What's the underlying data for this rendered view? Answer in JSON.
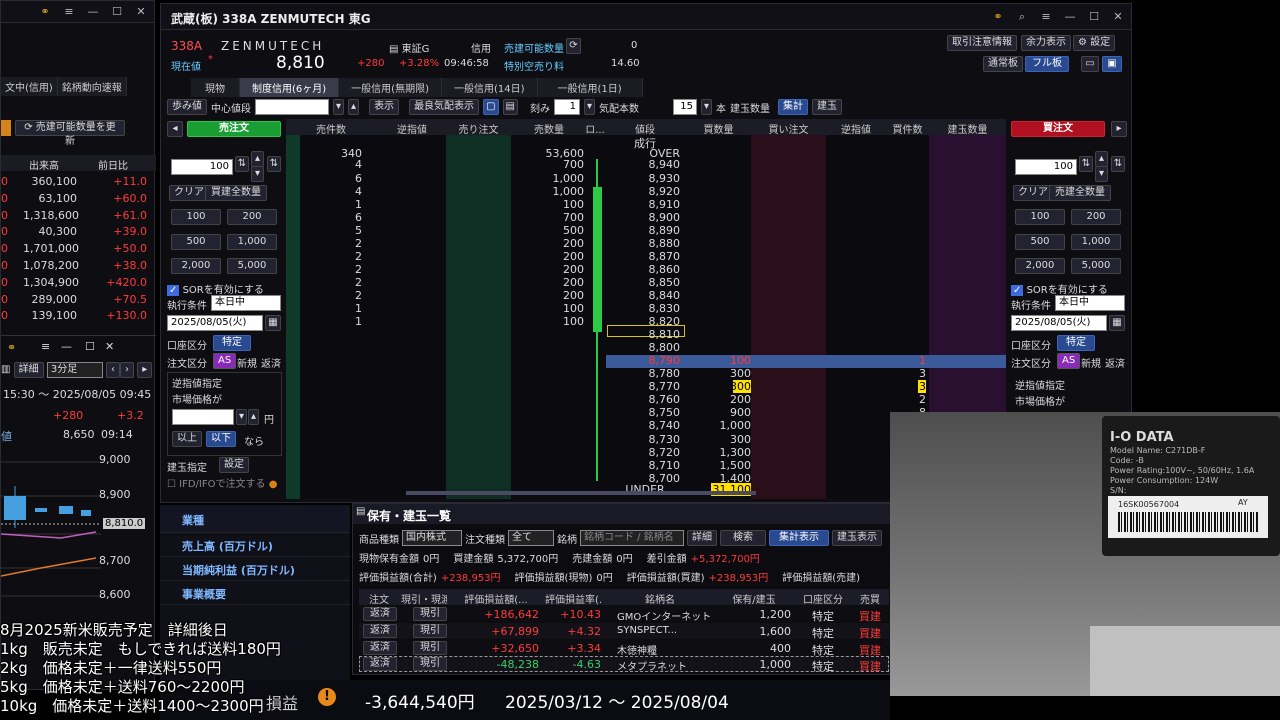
{
  "left_window": {
    "tabs": [
      "文中(信用)",
      "銘柄動向速報"
    ],
    "refresh_button": "売建可能数量を更新",
    "col_headers": [
      "出来高",
      "前日比"
    ],
    "rows": [
      {
        "vol": "360,100",
        "chg": "+11.0"
      },
      {
        "vol": "63,100",
        "chg": "+60.0"
      },
      {
        "vol": "1,318,600",
        "chg": "+61.0"
      },
      {
        "vol": "40,300",
        "chg": "+39.0"
      },
      {
        "vol": "1,701,000",
        "chg": "+50.0"
      },
      {
        "vol": "1,078,200",
        "chg": "+38.0"
      },
      {
        "vol": "1,304,900",
        "chg": "+420.0"
      },
      {
        "vol": "289,000",
        "chg": "+70.5"
      },
      {
        "vol": "139,100",
        "chg": "+130.0"
      }
    ],
    "chart": {
      "detail": "詳細",
      "interval": "3分足",
      "range": "15:30 ～ 2025/08/05 09:45",
      "chg1": "+280",
      "chg2": "+3.2",
      "label": "値",
      "price": "8,650",
      "time": "09:14",
      "yticks": [
        "9,000",
        "8,900",
        "8,810.0",
        "8,700",
        "8,600"
      ]
    }
  },
  "main": {
    "title": "武蔵(板) 338A ZENMUTECH 東G",
    "code": "338A",
    "name": "ZENMUTECH",
    "market": "東証G",
    "credit": "信用",
    "sellable_label": "売建可能数量",
    "sellable_val": "0",
    "special_label": "特別空売り料",
    "special_val": "14.60",
    "cur_label": "現在値",
    "price": "8,810",
    "chg": "+280",
    "pct": "+3.28%",
    "time": "09:46:58",
    "btn_notice": "取引注意情報",
    "btn_margin": "余力表示",
    "btn_settings": "設定",
    "mode_normal": "通常板",
    "mode_full": "フル板",
    "tabs": [
      "現物",
      "制度信用(6ヶ月)",
      "一般信用(無期限)",
      "一般信用(14日)",
      "一般信用(1日)"
    ],
    "toolbar": {
      "ayumi": "歩み値",
      "center": "中心値段",
      "display": "表示",
      "best": "最良気配表示",
      "tick_label": "刻み",
      "tick_val": "1",
      "depth_label": "気配本数",
      "depth_val": "15",
      "unit": "本",
      "position": "建玉数量",
      "summary": "集計",
      "build": "建玉"
    },
    "book_headers": [
      "売件数",
      "逆指値",
      "売り注文",
      "売数量",
      "ロ...",
      "値段",
      "買数量",
      "買い注文",
      "逆指値",
      "買件数",
      "建玉数量"
    ],
    "market_order": "成行",
    "over": {
      "label": "OVER",
      "qty": "53,600",
      "count": "340"
    },
    "asks": [
      {
        "count": "4",
        "qty": "700",
        "price": "8,940"
      },
      {
        "count": "6",
        "qty": "1,000",
        "price": "8,930"
      },
      {
        "count": "4",
        "qty": "1,000",
        "price": "8,920"
      },
      {
        "count": "1",
        "qty": "100",
        "price": "8,910"
      },
      {
        "count": "6",
        "qty": "700",
        "price": "8,900"
      },
      {
        "count": "5",
        "qty": "500",
        "price": "8,890"
      },
      {
        "count": "2",
        "qty": "200",
        "price": "8,880"
      },
      {
        "count": "2",
        "qty": "200",
        "price": "8,870"
      },
      {
        "count": "2",
        "qty": "200",
        "price": "8,860"
      },
      {
        "count": "2",
        "qty": "200",
        "price": "8,850"
      },
      {
        "count": "2",
        "qty": "200",
        "price": "8,840"
      },
      {
        "count": "1",
        "qty": "100",
        "price": "8,830"
      },
      {
        "count": "1",
        "qty": "100",
        "price": "8,820"
      }
    ],
    "current": "8,810",
    "mid": "8,800",
    "bids": [
      {
        "price": "8,790",
        "qty": "100",
        "count": "1"
      },
      {
        "price": "8,780",
        "qty": "300",
        "count": "3"
      },
      {
        "price": "8,770",
        "qty": "300",
        "count": "3"
      },
      {
        "price": "8,760",
        "qty": "200",
        "count": "2"
      },
      {
        "price": "8,750",
        "qty": "900",
        "count": "8"
      },
      {
        "price": "8,740",
        "qty": "1,000",
        "count": ""
      },
      {
        "price": "8,730",
        "qty": "300",
        "count": ""
      },
      {
        "price": "8,720",
        "qty": "1,300",
        "count": ""
      },
      {
        "price": "8,710",
        "qty": "1,500",
        "count": ""
      },
      {
        "price": "8,700",
        "qty": "1,400",
        "count": ""
      }
    ],
    "under": {
      "label": "UNDER",
      "qty": "31,100"
    },
    "sell_panel": {
      "title": "売注文",
      "qty": "100",
      "clear": "クリア",
      "allpos": "買建全数量",
      "q": [
        "100",
        "200",
        "500",
        "1,000",
        "2,000",
        "5,000"
      ],
      "sor": "SORを有効にする",
      "cond_label": "執行条件",
      "cond": "本日中",
      "date": "2025/08/05(火)",
      "acct_label": "口座区分",
      "acct": "特定",
      "order_label": "注文区分",
      "as": "AS",
      "new": "新規",
      "close": "返済",
      "stop": "逆指値指定",
      "mkt_price": "市場価格が",
      "yen": "円",
      "above": "以上",
      "below": "以下",
      "then": "なら",
      "pos_label": "建玉指定",
      "set": "設定",
      "ifd": "IFD/IFOで注文する"
    },
    "buy_panel": {
      "title": "買注文",
      "qty": "100",
      "clear": "クリア",
      "allpos": "売建全数量",
      "q": [
        "100",
        "200",
        "500",
        "1,000",
        "2,000",
        "5,000"
      ],
      "sor": "SORを有効にする",
      "cond_label": "執行条件",
      "cond": "本日中",
      "date": "2025/08/05(火)",
      "acct_label": "口座区分",
      "acct": "特定",
      "order_label": "注文区分",
      "as": "AS",
      "new": "新規",
      "close": "返済",
      "stop": "逆指値指定",
      "mkt_price": "市場価格が"
    }
  },
  "info_panel": [
    "業種",
    "売上高 (百万ドル)",
    "当期純利益 (百万ドル)",
    "事業概要"
  ],
  "holdings": {
    "title": "保有・建玉一覧",
    "f_type_label": "商品種類",
    "f_type": "国内株式",
    "f_order_label": "注文種類",
    "f_order": "全て",
    "f_stock_label": "銘柄",
    "f_stock_ph": "銘柄コード / 銘柄名",
    "detail": "詳細",
    "search": "検索",
    "summary": "集計表示",
    "build": "建玉表示",
    "s1_label": "現物保有金額",
    "s1": "0円",
    "s2_label": "買建金額",
    "s2": "5,372,700円",
    "s3_label": "売建金額",
    "s3": "0円",
    "s4_label": "差引金額",
    "s4": "+5,372,700円",
    "p1_label": "評価損益額(合計)",
    "p1": "+238,953円",
    "p2_label": "評価損益額(現物)",
    "p2": "0円",
    "p3_label": "評価損益額(買建)",
    "p3": "+238,953円",
    "p4_label": "評価損益額(売建)",
    "headers": [
      "注文",
      "現引・現渡",
      "評価損益額(...",
      "評価損益率(...",
      "銘柄名",
      "保有/建玉",
      "口座区分",
      "売買"
    ],
    "rows": [
      {
        "a": "返済",
        "b": "現引",
        "pl": "+186,642",
        "pct": "+10.43",
        "name": "GMOインターネット",
        "qty": "1,200",
        "acct": "特定",
        "side": "買建"
      },
      {
        "a": "返済",
        "b": "現引",
        "pl": "+67,899",
        "pct": "+4.32",
        "name": "SYNSPECT...",
        "qty": "1,600",
        "acct": "特定",
        "side": "買建"
      },
      {
        "a": "返済",
        "b": "現引",
        "pl": "+32,650",
        "pct": "+3.34",
        "name": "木徳神糧",
        "qty": "400",
        "acct": "特定",
        "side": "買建"
      },
      {
        "a": "返済",
        "b": "現引",
        "pl": "-48,238",
        "pct": "-4.63",
        "name": "メタプラネット",
        "qty": "1,000",
        "acct": "特定",
        "side": "買建"
      }
    ]
  },
  "bottom": {
    "label": "損益",
    "total": "-3,644,540円",
    "period": "2025/03/12 ～ 2025/08/04"
  },
  "overlay": [
    "8月2025新米販売予定　詳細後日",
    "1kg　販売未定　もしできれば送料180円",
    "2kg　価格未定＋一律送料550円",
    "5kg　価格未定＋送料760～2200円",
    "10kg　価格未定＋送料1400～2300円"
  ],
  "camera": {
    "brand": "I-O DATA",
    "model_label": "Model Name:",
    "model": "C271DB-F",
    "code_label": "Code:",
    "code": "-B",
    "rating_label": "Power Rating:",
    "rating": "100V~, 50/60Hz, 1.6A",
    "power_label": "Power Consumption:",
    "power": "124W",
    "sn_label": "S/N:",
    "serial": "16SK00567004",
    "serial_suffix": "AY"
  }
}
